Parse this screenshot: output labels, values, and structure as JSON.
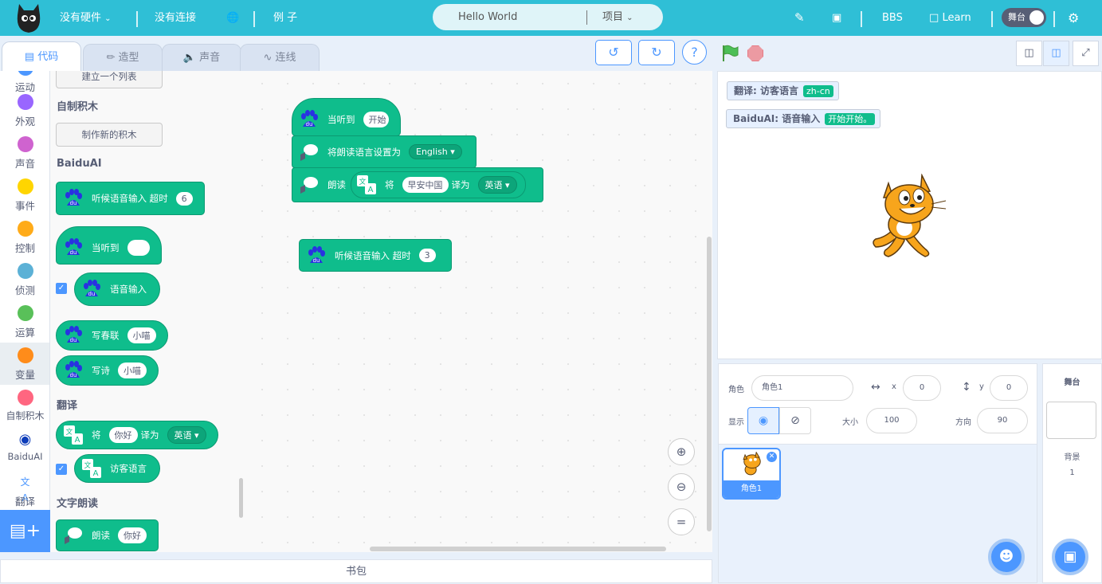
{
  "topbar": {
    "hardware": "没有硬件",
    "connection": "没有连接",
    "examples": "例 子",
    "project_title": "Hello World",
    "project_menu": "项目",
    "bbs": "BBS",
    "learn": "Learn",
    "stage_toggle": "舞台"
  },
  "tabs": [
    "代码",
    "造型",
    "声音",
    "连线"
  ],
  "categories": [
    {
      "label": "运动",
      "color": "#4c97ff"
    },
    {
      "label": "外观",
      "color": "#9966ff"
    },
    {
      "label": "声音",
      "color": "#cf63cf"
    },
    {
      "label": "事件",
      "color": "#ffd500"
    },
    {
      "label": "控制",
      "color": "#ffab19"
    },
    {
      "label": "侦测",
      "color": "#5cb1d6"
    },
    {
      "label": "运算",
      "color": "#59c059"
    },
    {
      "label": "变量",
      "color": "#ff8c1a"
    },
    {
      "label": "自制积木",
      "color": "#ff6680"
    },
    {
      "label": "BaiduAI",
      "color": "#0b3bb8"
    },
    {
      "label": "翻译",
      "color": "#4c97ff"
    }
  ],
  "palette": {
    "make_list": "建立一个列表",
    "my_blocks_title": "自制积木",
    "make_block": "制作新的积木",
    "baiduai_title": "BaiduAI",
    "listen_timeout": "听候语音输入 超时",
    "listen_timeout_val": "6",
    "when_hear": "当听到",
    "speech_input": "语音输入",
    "couplet": "写春联",
    "couplet_val": "小喵",
    "poem": "写诗",
    "poem_val": "小喵",
    "translate_title": "翻译",
    "translate_pre": "将",
    "translate_val": "你好",
    "translate_mid": "译为",
    "translate_lang": "英语",
    "visitor_lang": "访客语言",
    "tts_title": "文字朗读",
    "speak": "朗读",
    "speak_val": "你好"
  },
  "workspace": {
    "hat_label": "当听到",
    "hat_val": "开始",
    "set_lang": "将朗读语言设置为",
    "set_lang_val": "English",
    "speak": "朗读",
    "tr_pre": "将",
    "tr_val": "早安中国",
    "tr_mid": "译为",
    "tr_lang": "英语",
    "listen": "听候语音输入 超时",
    "listen_val": "3"
  },
  "stage": {
    "mon1_label": "翻译: 访客语言",
    "mon1_val": "zh-cn",
    "mon2_label": "BaiduAI: 语音输入",
    "mon2_val": "开始开始。"
  },
  "sprite_info": {
    "sprite_label": "角色",
    "sprite_name": "角色1",
    "x_label": "x",
    "x": "0",
    "y_label": "y",
    "y": "0",
    "show_label": "显示",
    "size_label": "大小",
    "size": "100",
    "dir_label": "方向",
    "direction": "90"
  },
  "sprite_list": [
    {
      "name": "角色1"
    }
  ],
  "stage_panel": {
    "title": "舞台",
    "backdrops_label": "背景",
    "backdrops_count": "1"
  },
  "backpack": "书包"
}
